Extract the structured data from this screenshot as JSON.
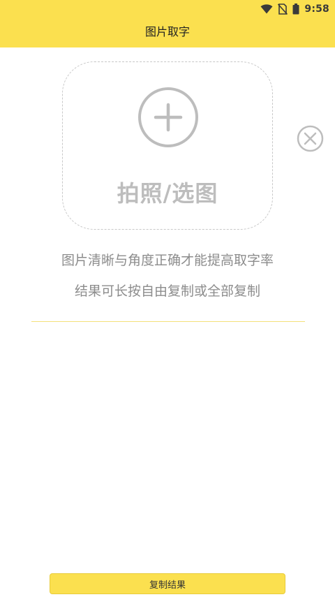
{
  "status_bar": {
    "time": "9:58",
    "icons": [
      "wifi-icon",
      "no-sim-icon",
      "battery-icon"
    ]
  },
  "app_bar": {
    "title": "图片取字"
  },
  "picker": {
    "label": "拍照/选图",
    "icon": "plus-circle-icon"
  },
  "close": {
    "icon": "close-circle-icon"
  },
  "hints": [
    "图片清晰与角度正确才能提高取字率",
    "结果可长按自由复制或全部复制"
  ],
  "result": {
    "text": ""
  },
  "copy_button": {
    "label": "复制结果"
  },
  "colors": {
    "accent": "#fbe04f",
    "hint_text": "#8c8c8c",
    "icon_gray": "#bdbdbd",
    "divider": "#f3e07a"
  }
}
